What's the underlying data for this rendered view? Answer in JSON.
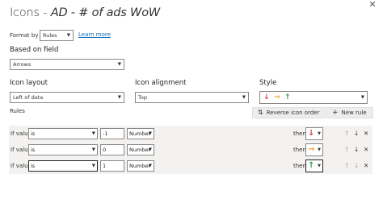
{
  "dialog": {
    "title_prefix": "Icons - ",
    "title_measure": "AD - # of ads WoW",
    "close_glyph": "✕"
  },
  "format_by": {
    "label": "Format by",
    "value": "Rules",
    "learn_more": "Learn more"
  },
  "based_on_field": {
    "label": "Based on field",
    "value": "Arrows"
  },
  "icon_layout": {
    "label": "Icon layout",
    "value": "Left of data"
  },
  "icon_alignment": {
    "label": "Icon alignment",
    "value": "Top"
  },
  "style": {
    "label": "Style",
    "icons": [
      "↓",
      "→",
      "↑"
    ],
    "icon_colors": [
      "#d64541",
      "#f2a33a",
      "#2f9e44"
    ]
  },
  "rules_heading": "Rules",
  "buttons": {
    "reverse_icon_order": "Reverse icon order",
    "new_rule": "New rule",
    "reverse_icon": "⇅",
    "new_rule_icon": "+"
  },
  "rules": [
    {
      "if_value": "If value",
      "operator": "is",
      "value": "-1",
      "type": "Number",
      "then": "then",
      "icon": "↓",
      "icon_color": "#d64541"
    },
    {
      "if_value": "If value",
      "operator": "is",
      "value": "0",
      "type": "Number",
      "then": "then",
      "icon": "→",
      "icon_color": "#f2a33a"
    },
    {
      "if_value": "If value",
      "operator": "is",
      "value": "1",
      "type": "Number",
      "then": "then",
      "icon": "↑",
      "icon_color": "#2f9e44"
    }
  ],
  "row_controls": {
    "up": "↑",
    "down": "↓",
    "delete": "✕"
  },
  "dropdown_glyph": "▼"
}
